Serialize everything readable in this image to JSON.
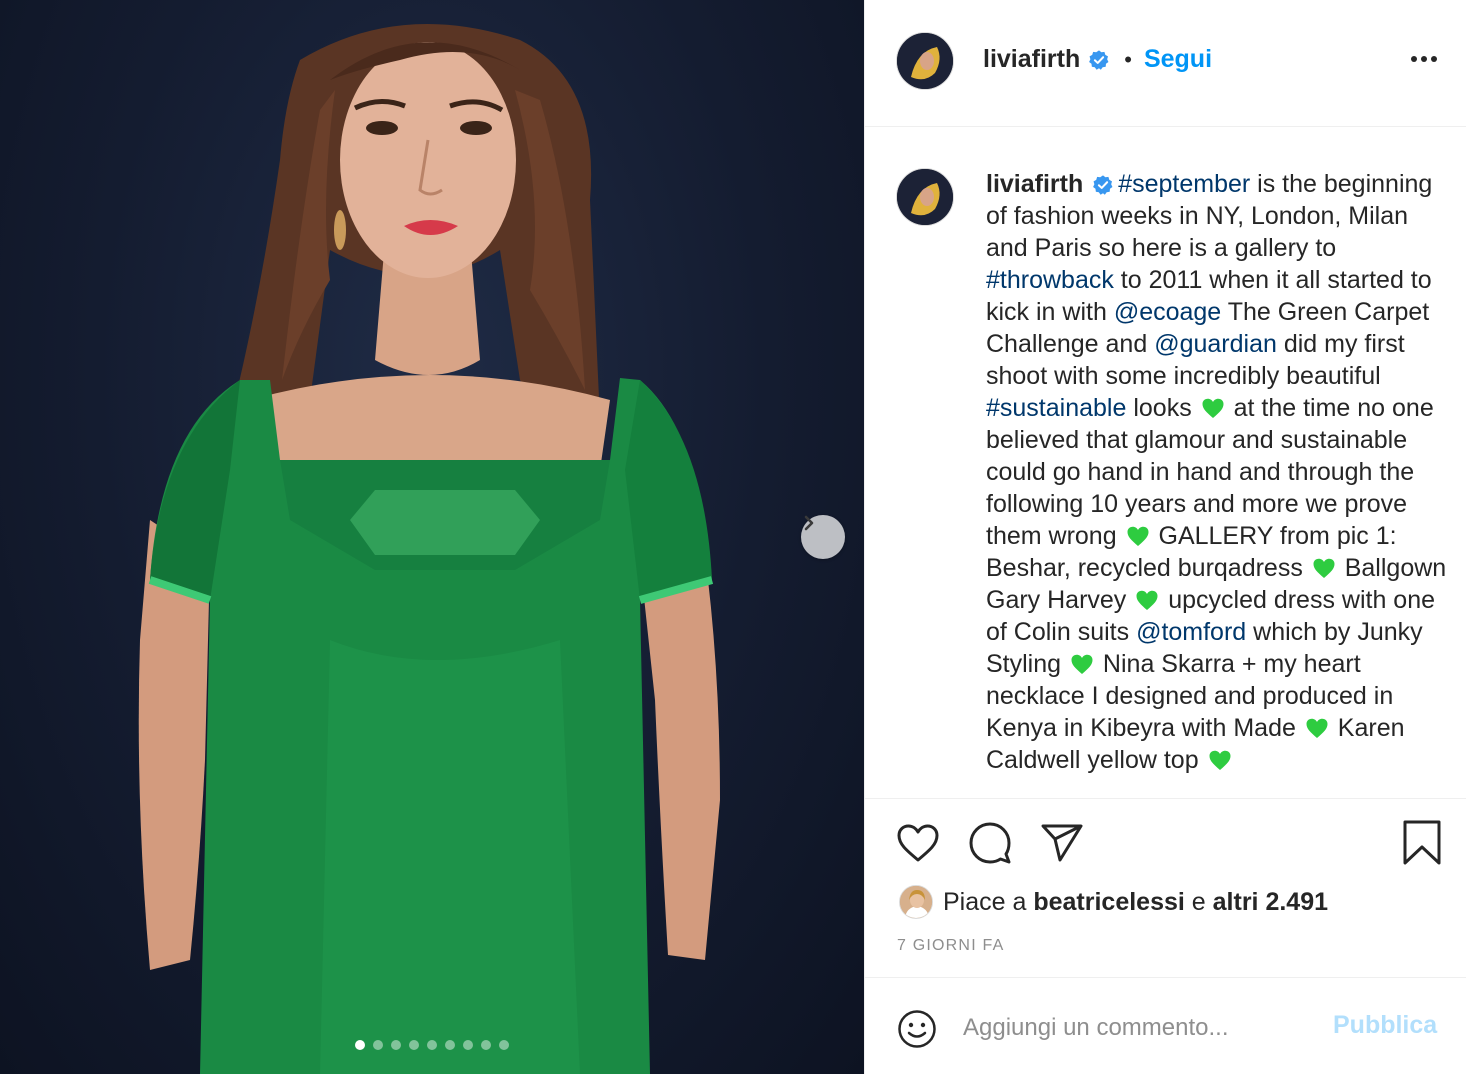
{
  "post": {
    "username": "liviafirth",
    "follow_label": "Segui",
    "separator": "•",
    "more_icon": "more-horizontal-icon",
    "verified_icon": "verified-badge-icon"
  },
  "media": {
    "description_icon": "photo",
    "carousel_total": 9,
    "carousel_index": 1,
    "next_icon": "chevron-right-icon"
  },
  "caption": {
    "username": "liviafirth",
    "segments": [
      {
        "t": "#september",
        "link": true
      },
      {
        "t": " is the beginning of fashion weeks in NY, London, Milan and Paris so here is a gallery to "
      },
      {
        "t": "#throwback",
        "link": true
      },
      {
        "t": " to 2011 when it all started to kick in with "
      },
      {
        "t": "@ecoage",
        "link": true
      },
      {
        "t": " The Green Carpet Challenge and "
      },
      {
        "t": "@guardian",
        "link": true
      },
      {
        "t": " did my first shoot with some incredibly beautiful "
      },
      {
        "t": "#sustainable",
        "link": true
      },
      {
        "t": " looks "
      },
      {
        "emoji": "green-heart"
      },
      {
        "t": " at the time no one believed that glamour and sustainable could go hand in hand and through the following 10 years and more we prove them wrong "
      },
      {
        "emoji": "green-heart"
      },
      {
        "t": " GALLERY from pic 1: Beshar, recycled burqadress "
      },
      {
        "emoji": "green-heart"
      },
      {
        "t": " Ballgown Gary Harvey "
      },
      {
        "emoji": "green-heart"
      },
      {
        "t": " upcycled dress with one of Colin suits "
      },
      {
        "t": "@tomford",
        "link": true
      },
      {
        "t": " which by Junky Styling "
      },
      {
        "emoji": "green-heart"
      },
      {
        "t": " Nina Skarra + my heart necklace I designed and produced in Kenya in Kibeyra with Made "
      },
      {
        "emoji": "green-heart"
      },
      {
        "t": " Karen Caldwell yellow top "
      },
      {
        "emoji": "green-heart"
      }
    ]
  },
  "actions": {
    "like_icon": "heart-icon",
    "comment_icon": "comment-icon",
    "share_icon": "paper-plane-icon",
    "save_icon": "bookmark-icon"
  },
  "likes": {
    "prefix": "Piace a",
    "user": "beatricelessi",
    "conj": "e",
    "others": "altri 2.491"
  },
  "timestamp": "7 GIORNI FA",
  "comment": {
    "placeholder": "Aggiungi un commento...",
    "publish_label": "Pubblica",
    "emoji_icon": "smiley-icon"
  },
  "colors": {
    "accent": "#0095f6",
    "link": "#00376b",
    "publish_disabled": "#b2dffc",
    "emoji_green": "#2ecc40"
  }
}
